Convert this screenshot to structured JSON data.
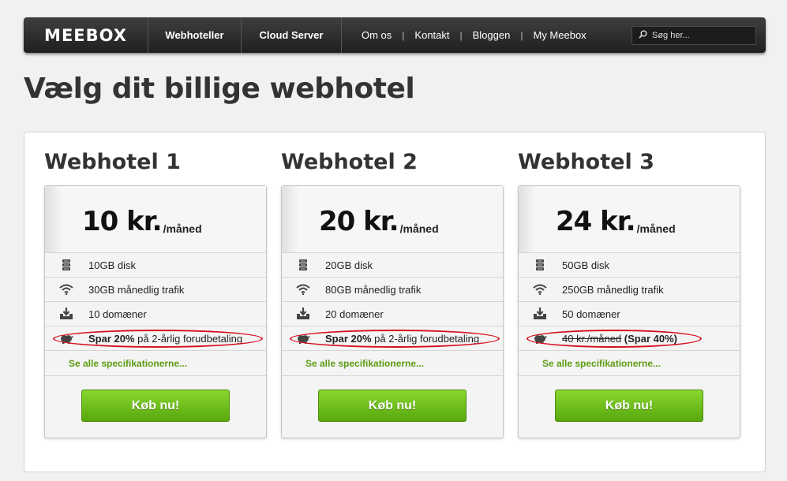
{
  "nav": {
    "logo": "MEEBOX",
    "main_items": [
      "Webhoteller",
      "Cloud Server"
    ],
    "links": [
      "Om os",
      "Kontakt",
      "Bloggen",
      "My Meebox"
    ],
    "separator": "|",
    "search_placeholder": "Søg her..."
  },
  "page_title": "Vælg dit billige webhotel",
  "plans": [
    {
      "title": "Webhotel 1",
      "price": "10 kr.",
      "unit": "/måned",
      "disk": "10GB disk",
      "traffic": "30GB månedlig trafik",
      "domains": "10 domæner",
      "offer_bold": "Spar 20%",
      "offer_rest": " på 2-årlig forudbetaling",
      "spec_link": "Se alle specifikationerne...",
      "buy": "Køb nu!"
    },
    {
      "title": "Webhotel 2",
      "price": "20 kr.",
      "unit": "/måned",
      "disk": "20GB disk",
      "traffic": "80GB månedlig trafik",
      "domains": "20 domæner",
      "offer_bold": "Spar 20%",
      "offer_rest": " på 2-årlig forudbetaling",
      "spec_link": "Se alle specifikationerne...",
      "buy": "Køb nu!"
    },
    {
      "title": "Webhotel 3",
      "price": "24 kr.",
      "unit": "/måned",
      "disk": "50GB disk",
      "traffic": "250GB månedlig trafik",
      "domains": "50 domæner",
      "offer_strike": "40 kr./måned",
      "offer_bold": " (Spar 40%)",
      "spec_link": "Se alle specifikationerne...",
      "buy": "Køb nu!"
    }
  ],
  "icons": {
    "disk": "server-icon",
    "traffic": "wifi-icon",
    "domains": "download-tray-icon",
    "offer": "piggy-bank-icon",
    "search": "magnifier-icon"
  },
  "colors": {
    "accent_green": "#5d9c12",
    "button_green": "#6cbf1f",
    "highlight_red": "#d6101c",
    "nav_dark": "#2a2a2a"
  }
}
